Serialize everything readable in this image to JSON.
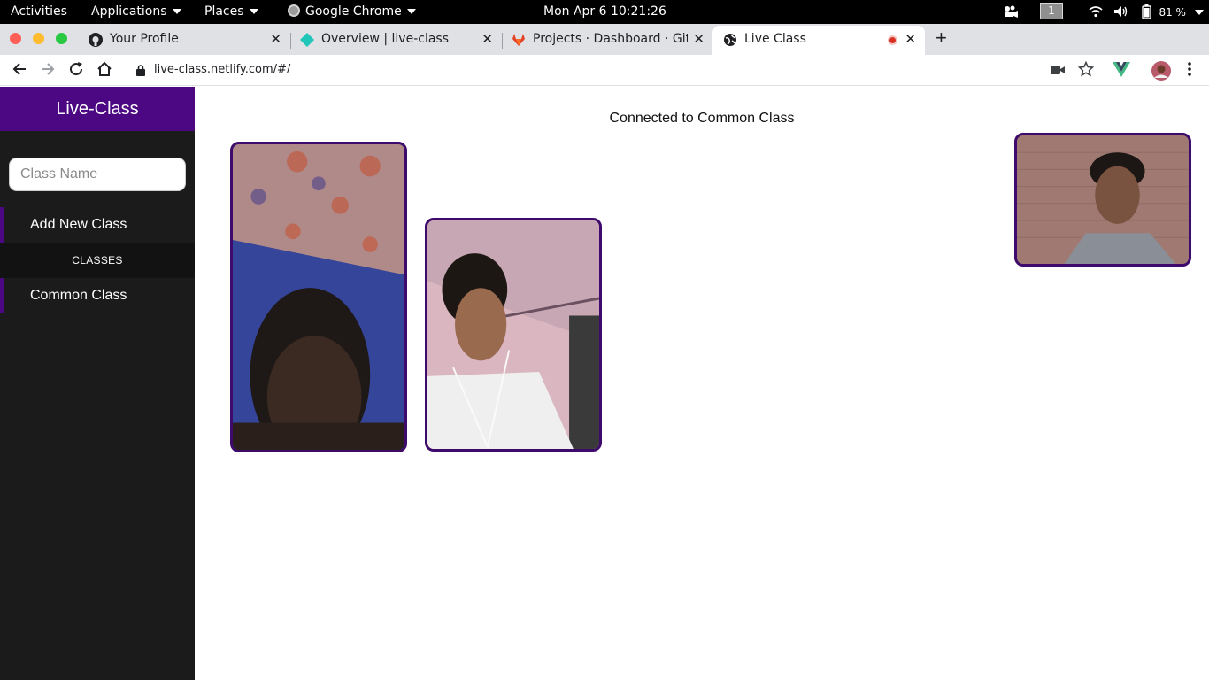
{
  "system": {
    "activities": "Activities",
    "applications": "Applications",
    "places": "Places",
    "app_name": "Google Chrome",
    "clock": "Mon Apr 6  10:21:26",
    "workspace": "1",
    "battery": "81 %"
  },
  "tabs": [
    {
      "title": "Your Profile",
      "icon": "github-icon"
    },
    {
      "title": "Overview | live-class",
      "icon": "netlify-icon"
    },
    {
      "title": "Projects · Dashboard · GitL",
      "icon": "gitlab-icon"
    },
    {
      "title": "Live Class",
      "icon": "globe-icon",
      "recording": true
    }
  ],
  "address_bar": {
    "url": "live-class.netlify.com/#/"
  },
  "sidebar": {
    "brand": "Live-Class",
    "class_input_placeholder": "Class Name",
    "add_new_class": "Add New Class",
    "section_header": "CLASSES",
    "classes": [
      "Common Class"
    ]
  },
  "main": {
    "status": "Connected to Common Class"
  },
  "colors": {
    "brand": "#4b0882",
    "sidebar_bg": "#1b1b1b",
    "video_border": "#3e0a6b"
  }
}
